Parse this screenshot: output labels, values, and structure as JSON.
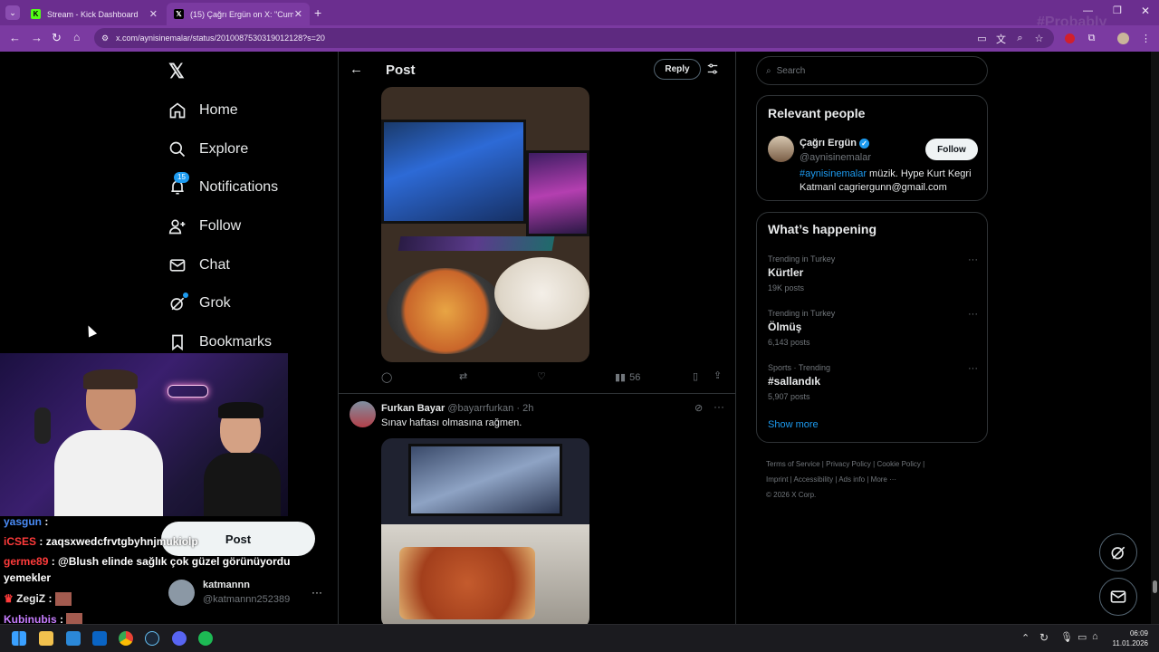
{
  "browser": {
    "tabs": [
      {
        "title": "Stream - Kick Dashboard",
        "active": false,
        "icon": "kick-icon"
      },
      {
        "title": "(15) Çağrı Ergün on X: \"Cumarte",
        "active": true,
        "icon": "x-icon"
      }
    ],
    "url": "x.com/aynisinemalar/status/2010087530319012128?s=20"
  },
  "sidebar": {
    "items": [
      {
        "label": "Home",
        "icon": "home-icon"
      },
      {
        "label": "Explore",
        "icon": "search-icon"
      },
      {
        "label": "Notifications",
        "icon": "bell-icon",
        "badge": "15"
      },
      {
        "label": "Follow",
        "icon": "person-add-icon"
      },
      {
        "label": "Chat",
        "icon": "mail-icon"
      },
      {
        "label": "Grok",
        "icon": "grok-icon"
      },
      {
        "label": "Bookmarks",
        "icon": "bookmark-icon"
      }
    ],
    "post_button": "Post",
    "account": {
      "name": "katmannn",
      "handle": "@katmannn252389",
      "more": "···"
    }
  },
  "header": {
    "title": "Post",
    "reply_button": "Reply"
  },
  "post1": {
    "views": "56"
  },
  "post2": {
    "author": "Furkan Bayar",
    "handle": "@bayarrfurkan",
    "time": "· 2h",
    "text": "Sınav haftası olmasına rağmen."
  },
  "right": {
    "search_placeholder": "Search",
    "relevant": {
      "title": "Relevant people",
      "name": "Çağrı Ergün",
      "handle": "@aynisinemalar",
      "follow": "Follow",
      "bio_tag": "#aynisinemalar",
      "bio_rest": " müzik. Hype Kurt Kegri Katmanl cagriergunn@gmail.com"
    },
    "happening": {
      "title": "What’s happening",
      "trends": [
        {
          "meta": "Trending in Turkey",
          "title": "Kürtler",
          "count": "19K posts"
        },
        {
          "meta": "Trending in Turkey",
          "title": "Ölmüş",
          "count": "6,143 posts"
        },
        {
          "meta": "Sports · Trending",
          "title": "#sallandık",
          "count": "5,907 posts"
        }
      ],
      "show_more": "Show more"
    },
    "footer": {
      "links": [
        "Terms of Service",
        "Privacy Policy",
        "Cookie Policy",
        "Imprint",
        "Accessibility",
        "Ads info",
        "More ···"
      ],
      "copyright": "© 2026 X Corp."
    }
  },
  "stream_chat": [
    {
      "user": "yasgun",
      "msg": ""
    },
    {
      "user": "iCSES",
      "msg": "zaqsxwedcfrvtgbyhnjmukiolp"
    },
    {
      "user": "germe89",
      "msg": "@Blush elinde sağlık çok güzel görünüyordu"
    },
    {
      "user": "",
      "msg": "yemekler"
    },
    {
      "user": "ZegiZ",
      "msg": ""
    },
    {
      "user": "Kubinubis",
      "msg": ""
    }
  ],
  "watermark": "#Probably",
  "taskbar": {
    "time": "06:09",
    "date": "11.01.2026"
  }
}
